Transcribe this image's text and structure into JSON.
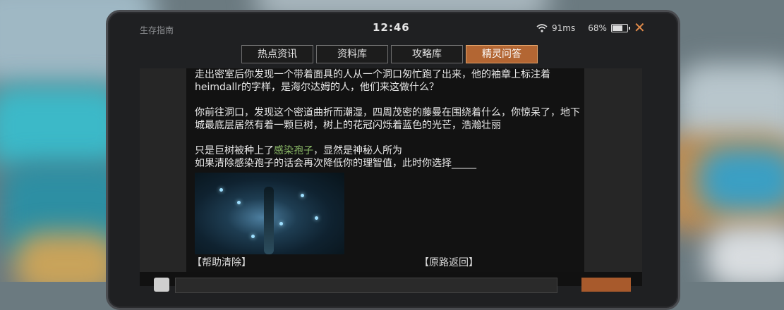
{
  "statusbar": {
    "app_title": "生存指南",
    "time": "12:46",
    "ping": "91ms",
    "battery": "68%",
    "close_symbol": "✕"
  },
  "tabs": [
    {
      "label": "热点资讯",
      "active": false
    },
    {
      "label": "资料库",
      "active": false
    },
    {
      "label": "攻略库",
      "active": false
    },
    {
      "label": "精灵问答",
      "active": true
    }
  ],
  "question": {
    "para1": "走出密室后你发现一个带着面具的人从一个洞口匆忙跑了出来，他的袖章上标注着heimdallr的字样，是海尔达姆的人，他们来这做什么？",
    "para2": "你前往洞口，发现这个密道曲折而潮湿，四周茂密的藤曼在围绕着什么，你惊呆了，地下城最底层居然有着一颗巨树，树上的花冠闪烁着蓝色的光芒，浩瀚壮丽",
    "para3_prefix": "只是巨树被种上了",
    "para3_highlight": "感染孢子",
    "para3_suffix": "，显然是神秘人所为",
    "para4": "如果清除感染孢子的话会再次降低你的理智值，此时你选择_____"
  },
  "choices": {
    "a": "【帮助清除】",
    "b": "【原路返回】"
  },
  "icons": {
    "wifi": "wifi-icon",
    "battery": "battery-icon",
    "close": "close-icon"
  },
  "colors": {
    "accent": "#b36633",
    "highlight": "#8fbf6a",
    "close": "#e08a4a"
  }
}
